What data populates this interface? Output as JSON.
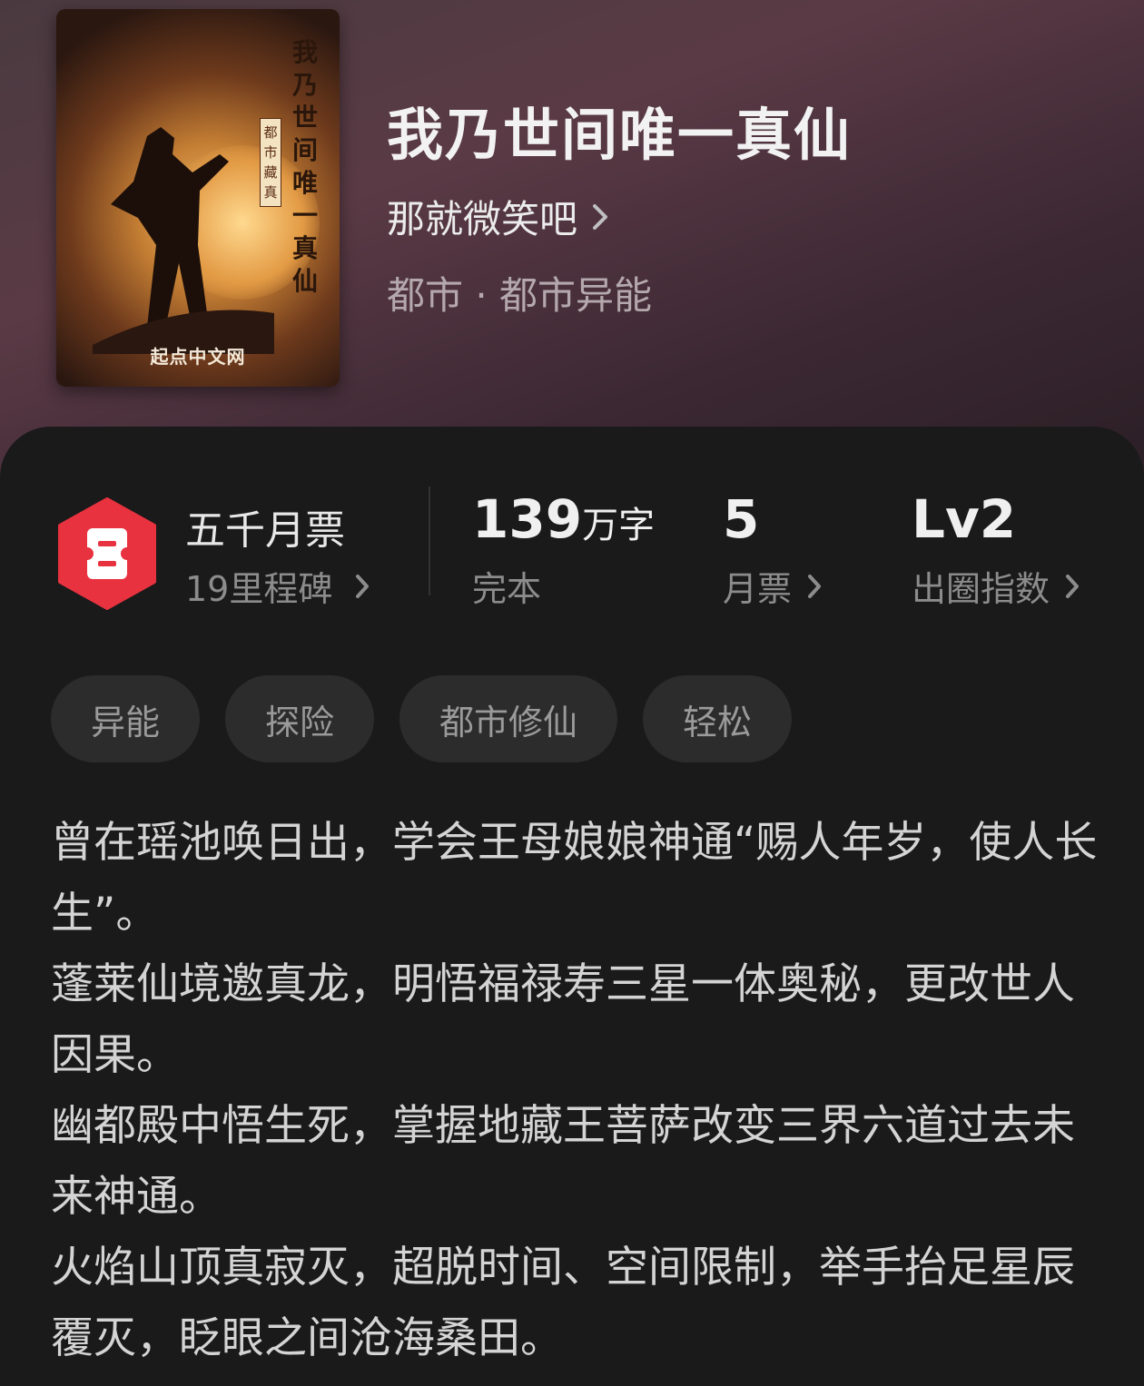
{
  "book": {
    "title": "我乃世间唯一真仙",
    "author": "那就微笑吧",
    "category": "都市 · 都市异能",
    "cover": {
      "vertical_title": "我乃世间唯一真仙",
      "vertical_label": "都市藏真",
      "publisher": "起点中文网"
    }
  },
  "stats": {
    "monthly_ticket_badge": {
      "title": "五千月票",
      "subtitle": "19里程碑",
      "badge_color": "#e8323f"
    },
    "word_count": {
      "value": "139",
      "unit": "万字",
      "label": "完本"
    },
    "monthly_tickets": {
      "value": "5",
      "label": "月票"
    },
    "influence": {
      "value": "Lv2",
      "label": "出圈指数"
    }
  },
  "tags": [
    "异能",
    "探险",
    "都市修仙",
    "轻松"
  ],
  "description": [
    "曾在瑶池唤日出，学会王母娘娘神通“赐人年岁，使人长生”。",
    "蓬莱仙境邀真龙，明悟福禄寿三星一体奥秘，更改世人因果。",
    "幽都殿中悟生死，掌握地藏王菩萨改变三界六道过去未来神通。",
    "火焰山顶真寂灭，超脱时间、空间限制，举手抬足星辰覆灭，眨眼之间沧海桑田。"
  ],
  "colors": {
    "header_gradient": "#5a3a45",
    "panel_background": "#1a1a1a",
    "tag_background": "#2c2c2c"
  }
}
